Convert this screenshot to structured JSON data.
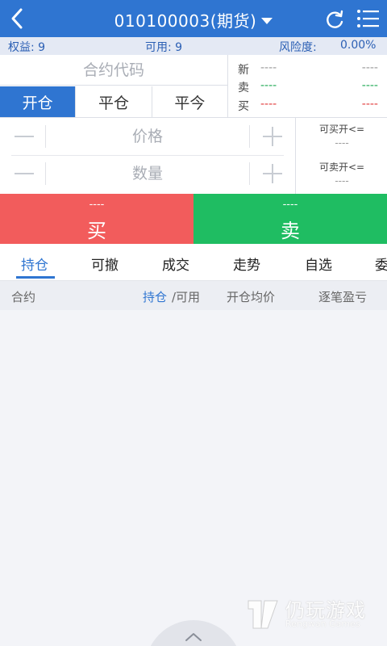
{
  "header": {
    "title": "010100003(期货)",
    "back_icon": "back-arrow-icon",
    "refresh_icon": "refresh-icon",
    "menu_icon": "list-menu-icon",
    "color": "#2f75d1"
  },
  "account": {
    "equity_label": "权益: 9",
    "available_label": "可用: 9",
    "risk_label": "风险度:",
    "risk_value": "0.00%"
  },
  "order": {
    "contract_placeholder": "合约代码",
    "mode_tabs": [
      "开仓",
      "平仓",
      "平今"
    ],
    "active_mode": "开仓",
    "quote": [
      {
        "label": "新",
        "v1": "----",
        "v2": "----",
        "color": "#999999"
      },
      {
        "label": "卖",
        "v1": "----",
        "v2": "----",
        "color": "#1ea853"
      },
      {
        "label": "买",
        "v1": "----",
        "v2": "----",
        "color": "#e23a3a"
      }
    ],
    "price_placeholder": "价格",
    "quantity_placeholder": "数量",
    "can_buy_label": "可买开<=",
    "can_buy_value": "----",
    "can_sell_label": "可卖开<=",
    "can_sell_value": "----"
  },
  "actions": {
    "buy_price": "----",
    "buy_label": "买",
    "buy_color": "#f25c5c",
    "sell_price": "----",
    "sell_label": "卖",
    "sell_color": "#1fbd62"
  },
  "tabs": [
    "持仓",
    "可撤",
    "成交",
    "走势",
    "自选",
    "委"
  ],
  "active_tab": "持仓",
  "list_header": {
    "contract": "合约",
    "position": "持仓",
    "slash_available": "/可用",
    "avg_open_price": "开仓均价",
    "pnl": "逐笔盈亏"
  },
  "watermark": {
    "name": "仍玩游戏",
    "sub": "Rengwan Games"
  }
}
